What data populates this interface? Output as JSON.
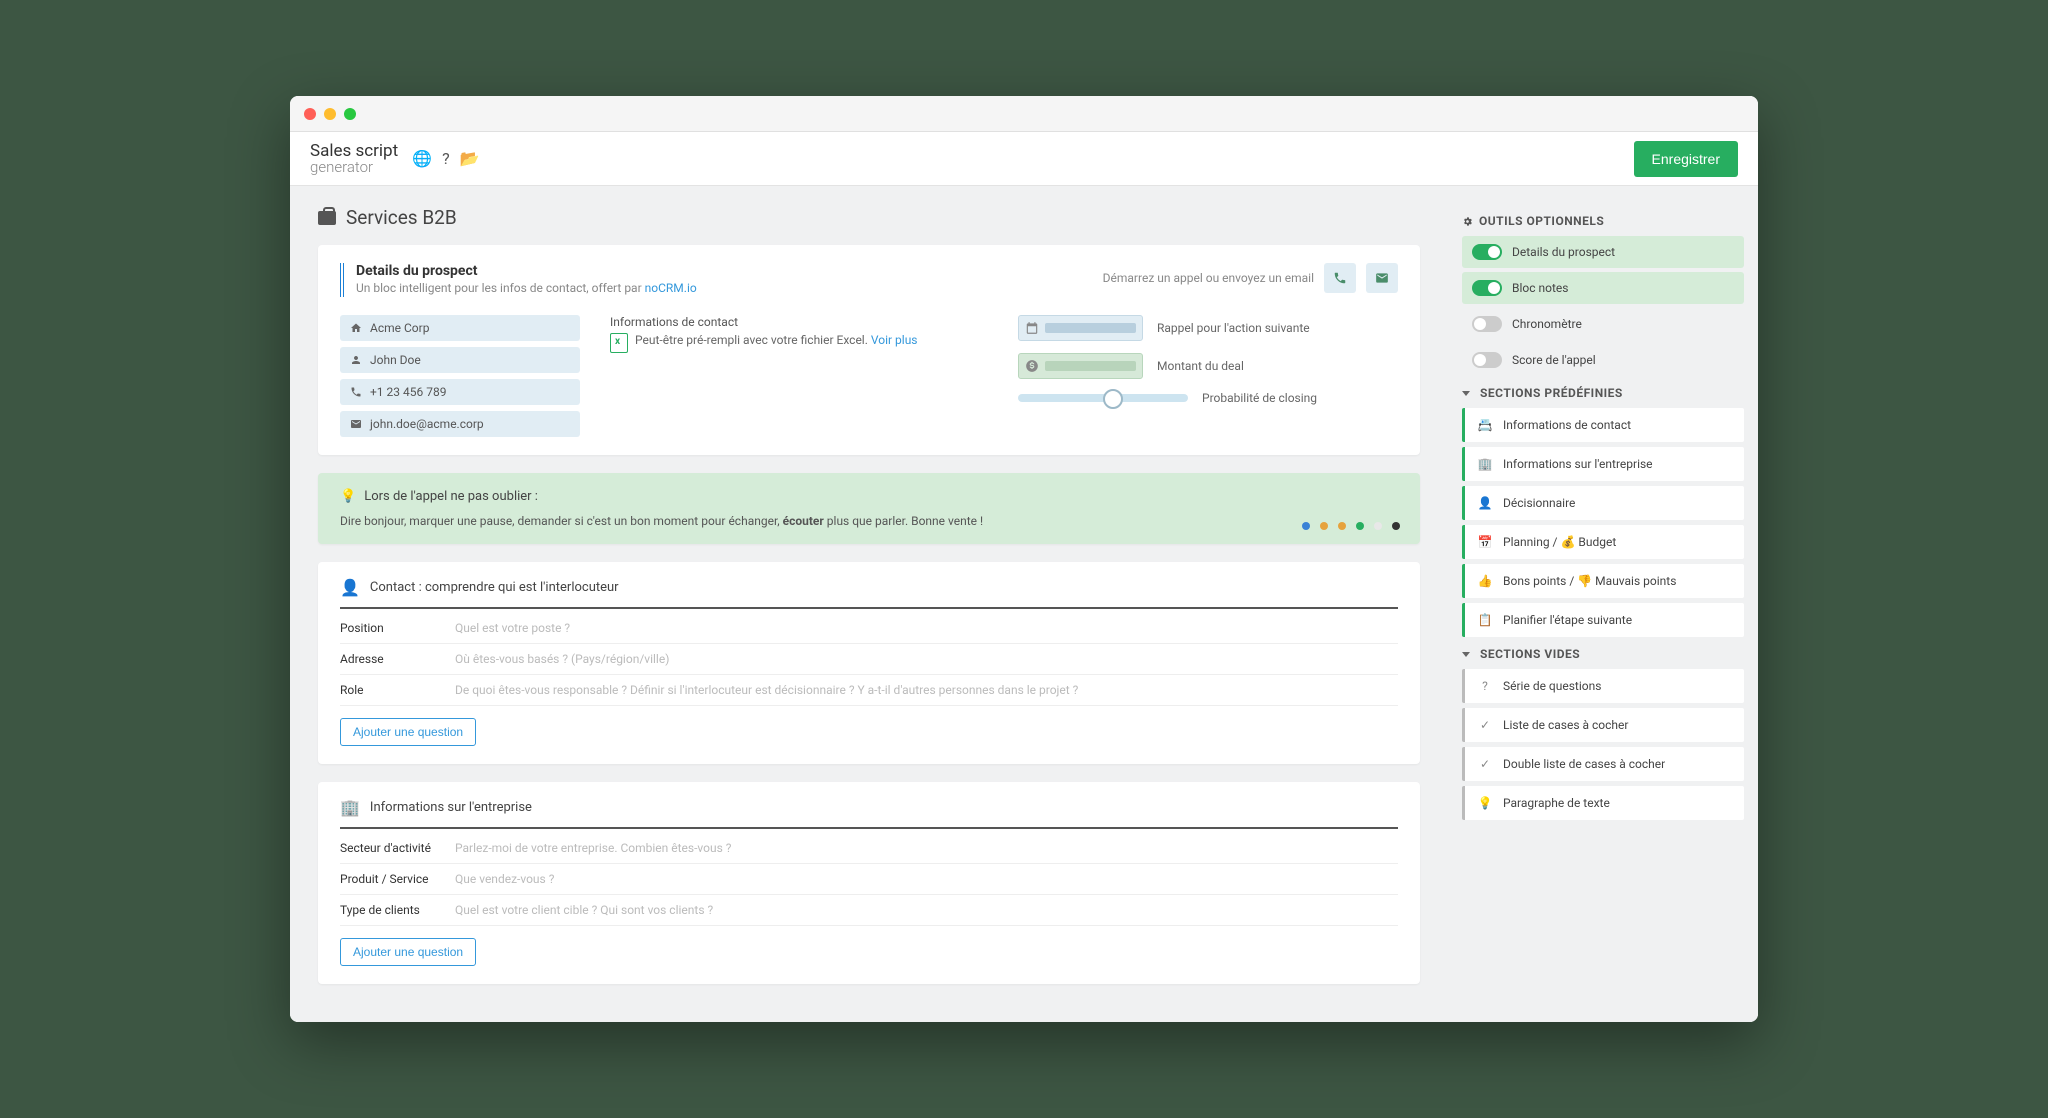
{
  "toolbar": {
    "save_label": "Enregistrer"
  },
  "page": {
    "title": "Services B2B"
  },
  "prospect": {
    "title": "Details du prospect",
    "subtitle_pre": "Un bloc intelligent pour les infos de contact, offert par ",
    "subtitle_link": "noCRM.io",
    "call_hint": "Démarrez un appel ou envoyez un email",
    "company": "Acme Corp",
    "person": "John Doe",
    "phone": "+1 23 456 789",
    "email": "john.doe@acme.corp",
    "contact_info_label": "Informations de contact",
    "excel_hint_pre": "Peut-être pré-rempli avec votre fichier Excel. ",
    "excel_hint_link": "Voir plus",
    "reminder_label": "Rappel pour l'action suivante",
    "deal_label": "Montant du deal",
    "prob_label": "Probabilité de closing"
  },
  "tip": {
    "title": "Lors de l'appel ne pas oublier :",
    "text_pre": "Dire bonjour, marquer une pause, demander si c'est un bon moment pour échanger, ",
    "text_bold": "écouter",
    "text_post": " plus que parler. Bonne vente !",
    "dot_colors": [
      "#3b82d6",
      "#e6a23c",
      "#e6a23c",
      "#27ae60",
      "#e8e8e8",
      "#333"
    ]
  },
  "sections": [
    {
      "icon": "👤",
      "title": "Contact : comprendre qui est l'interlocuteur",
      "questions": [
        {
          "label": "Position",
          "ph": "Quel est votre poste ?"
        },
        {
          "label": "Adresse",
          "ph": "Où êtes-vous basés ? (Pays/région/ville)"
        },
        {
          "label": "Role",
          "ph": "De quoi êtes-vous responsable ? Définir si l'interlocuteur est décisionnaire ? Y a-t-il d'autres personnes dans le projet ?"
        }
      ],
      "add": "Ajouter une question"
    },
    {
      "icon": "🏢",
      "title": "Informations sur l'entreprise",
      "questions": [
        {
          "label": "Secteur d'activité",
          "ph": "Parlez-moi de votre entreprise. Combien êtes-vous ?"
        },
        {
          "label": "Produit / Service",
          "ph": "Que vendez-vous ?"
        },
        {
          "label": "Type de clients",
          "ph": "Quel est votre client cible ? Qui sont vos clients ?"
        }
      ],
      "add": "Ajouter une question"
    }
  ],
  "sidebar": {
    "optional_title": "OUTILS OPTIONNELS",
    "toggles": [
      {
        "label": "Details du prospect",
        "on": true
      },
      {
        "label": "Bloc notes",
        "on": true
      },
      {
        "label": "Chronomètre",
        "on": false
      },
      {
        "label": "Score de l'appel",
        "on": false
      }
    ],
    "predef_title": "SECTIONS PRÉDÉFINIES",
    "predef": [
      {
        "icon": "📇",
        "label": "Informations de contact"
      },
      {
        "icon": "🏢",
        "label": "Informations sur l'entreprise"
      },
      {
        "icon": "👤",
        "label": "Décisionnaire"
      },
      {
        "icon": "📅",
        "label": "Planning / 💰 Budget"
      },
      {
        "icon": "👍",
        "label": "Bons points / 👎 Mauvais points"
      },
      {
        "icon": "📋",
        "label": "Planifier l'étape suivante"
      }
    ],
    "empty_title": "SECTIONS VIDES",
    "empty": [
      {
        "icon": "?",
        "label": "Série de questions"
      },
      {
        "icon": "✓",
        "label": "Liste de cases à cocher"
      },
      {
        "icon": "✓",
        "label": "Double liste de cases à cocher"
      },
      {
        "icon": "💡",
        "label": "Paragraphe de texte"
      }
    ]
  }
}
